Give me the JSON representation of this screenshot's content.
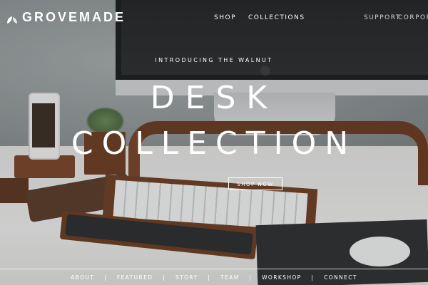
{
  "header": {
    "logo_text": "GROVEMADE",
    "nav_main": [
      "SHOP",
      "COLLECTIONS"
    ],
    "nav_secondary": [
      "SUPPORT",
      "CORPORATE"
    ]
  },
  "hero": {
    "kicker": "INTRODUCING THE WALNUT",
    "headline_line1": "DESK",
    "headline_line2": "COLLECTION",
    "cta_label": "SHOP NOW"
  },
  "footer": {
    "links": [
      "ABOUT",
      "FEATURED",
      "STORY",
      "TEAM",
      "WORKSHOP",
      "CONNECT"
    ],
    "separator": "|"
  },
  "colors": {
    "text": "#ffffff",
    "walnut": "#6f3d22"
  },
  "icons": {
    "logo": "leaf-icon",
    "monitor_brand": "apple-icon"
  }
}
